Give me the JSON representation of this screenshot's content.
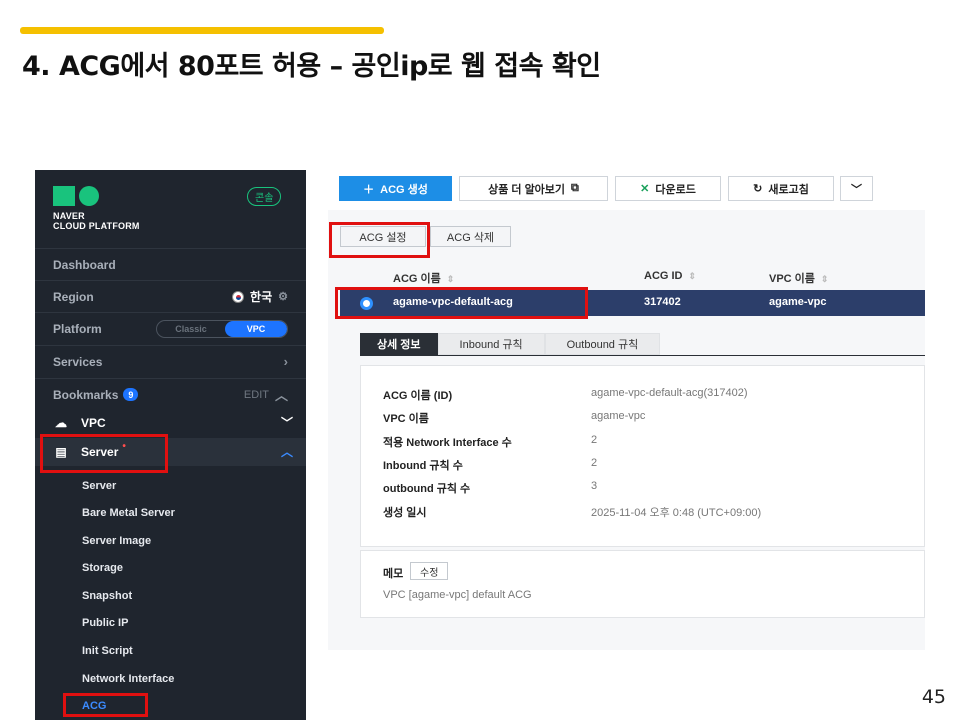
{
  "slide": {
    "title": "4. ACG에서 80포트 허용 – 공인ip로 웹 접속 확인",
    "page_number": "45"
  },
  "sidebar": {
    "logo_line1": "NAVER",
    "logo_line2": "CLOUD PLATFORM",
    "console_badge": "콘솔",
    "dashboard": "Dashboard",
    "region_label": "Region",
    "region_value": "한국",
    "platform_label": "Platform",
    "platform_classic": "Classic",
    "platform_vpc": "VPC",
    "services_label": "Services",
    "bookmarks_label": "Bookmarks",
    "bookmarks_count": "9",
    "edit_label": "EDIT",
    "vpc_label": "VPC",
    "server_label": "Server",
    "sub_items": [
      "Server",
      "Bare Metal Server",
      "Server Image",
      "Storage",
      "Snapshot",
      "Public IP",
      "Init Script",
      "Network Interface",
      "ACG"
    ]
  },
  "toolbar": {
    "create": "ACG 생성",
    "learn_more": "상품 더 알아보기",
    "download": "다운로드",
    "refresh": "새로고침"
  },
  "actions": {
    "settings": "ACG 설정",
    "delete": "ACG 삭제"
  },
  "table": {
    "headers": [
      "ACG 이름",
      "ACG ID",
      "VPC 이름"
    ],
    "row": {
      "name": "agame-vpc-default-acg",
      "id": "317402",
      "vpc": "agame-vpc"
    }
  },
  "tabs": [
    "상세 정보",
    "Inbound 규칙",
    "Outbound 규칙"
  ],
  "details": [
    {
      "label": "ACG 이름 (ID)",
      "value": "agame-vpc-default-acg(317402)"
    },
    {
      "label": "VPC 이름",
      "value": "agame-vpc"
    },
    {
      "label": "적용 Network Interface 수",
      "value": "2"
    },
    {
      "label": "Inbound 규칙 수",
      "value": "2"
    },
    {
      "label": "outbound 규칙 수",
      "value": "3"
    },
    {
      "label": "생성 일시",
      "value": "2025-11-04 오후 0:48 (UTC+09:00)"
    }
  ],
  "memo": {
    "label": "메모",
    "edit": "수정",
    "text": "VPC [agame-vpc] default ACG"
  },
  "colors": {
    "accent_bar": "#f5c000",
    "sidebar_bg": "#1f252e",
    "brand_green": "#19c37d",
    "primary_blue": "#1d8ee6",
    "selected_row": "#2c3e6a",
    "highlight_red": "#e01010"
  }
}
